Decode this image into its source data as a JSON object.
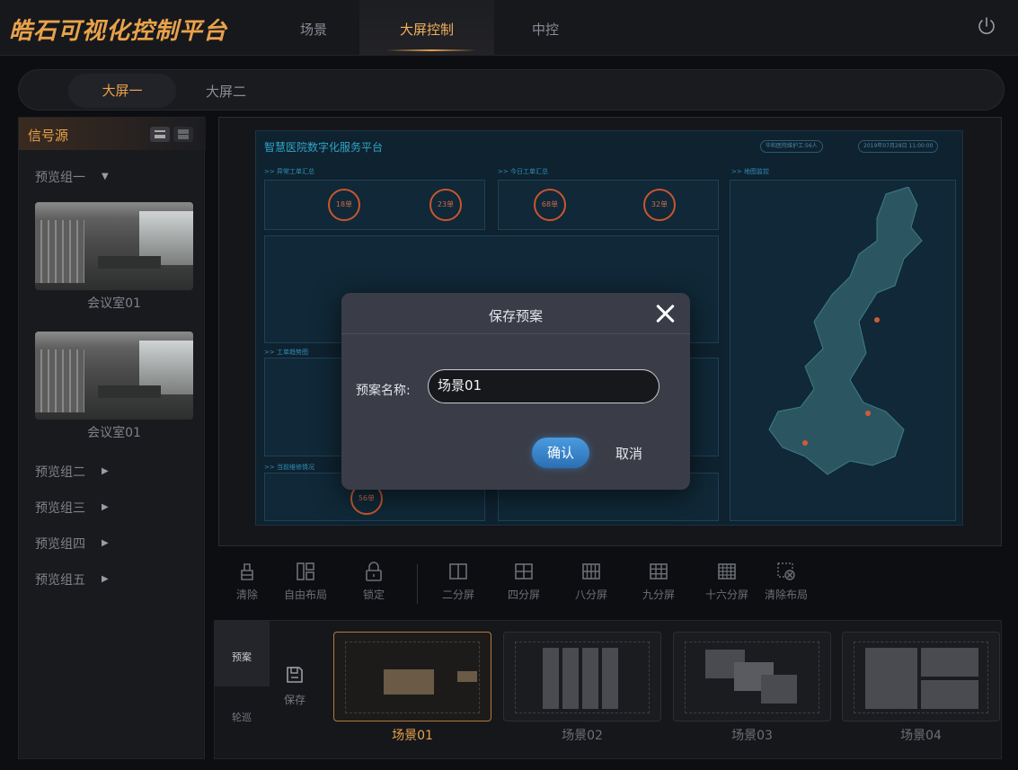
{
  "app": {
    "title": "皓石可视化控制平台"
  },
  "top_tabs": [
    {
      "label": "场景",
      "active": false
    },
    {
      "label": "大屏控制",
      "active": true
    },
    {
      "label": "中控",
      "active": false
    }
  ],
  "screen_tabs": [
    {
      "label": "大屏一",
      "active": true
    },
    {
      "label": "大屏二",
      "active": false
    }
  ],
  "sidebar": {
    "title": "信号源",
    "groups": [
      {
        "label": "预览组一",
        "expanded": true,
        "items": [
          {
            "label": "会议室01"
          },
          {
            "label": "会议室01"
          }
        ]
      },
      {
        "label": "预览组二",
        "expanded": false
      },
      {
        "label": "预览组三",
        "expanded": false
      },
      {
        "label": "预览组四",
        "expanded": false
      },
      {
        "label": "预览组五",
        "expanded": false
      }
    ]
  },
  "dashboard": {
    "title": "智慧医院数字化服务平台",
    "pill1": "华和医院维护工:56人",
    "pill2": "2019年07月28日 11:00:00",
    "sec_abnormal": ">> 异常工单汇总",
    "sec_today": ">> 今日工单汇总",
    "sec_map": ">> 地图监控",
    "sec_trend": ">> 工单趋势图",
    "sec_repair": ">> 当前维修情况",
    "c1": "18单",
    "c2": "23单",
    "c3": "68单",
    "c4": "32单",
    "c5": "56单"
  },
  "modal": {
    "title": "保存预案",
    "field_label": "预案名称:",
    "field_value": "场景01",
    "ok_label": "确认",
    "cancel_label": "取消"
  },
  "toolbar": [
    {
      "label": "清除",
      "icon": "clear-icon"
    },
    {
      "label": "自由布局",
      "icon": "free-layout-icon"
    },
    {
      "label": "锁定",
      "icon": "lock-icon"
    },
    {
      "label": "二分屏",
      "icon": "split-2-icon"
    },
    {
      "label": "四分屏",
      "icon": "split-4-icon"
    },
    {
      "label": "八分屏",
      "icon": "split-8-icon"
    },
    {
      "label": "九分屏",
      "icon": "split-9-icon"
    },
    {
      "label": "十六分屏",
      "icon": "split-16-icon"
    },
    {
      "label": "清除布局",
      "icon": "clear-layout-icon"
    }
  ],
  "preset_tabs": [
    {
      "label": "预案",
      "active": true
    },
    {
      "label": "轮巡",
      "active": false
    }
  ],
  "save_label": "保存",
  "scenes": [
    {
      "label": "场景01",
      "active": true
    },
    {
      "label": "场景02",
      "active": false
    },
    {
      "label": "场景03",
      "active": false
    },
    {
      "label": "场景04",
      "active": false
    }
  ],
  "colors": {
    "accent": "#e9a24a",
    "primary_button": "#3b88d4",
    "background": "#0d0e11"
  }
}
